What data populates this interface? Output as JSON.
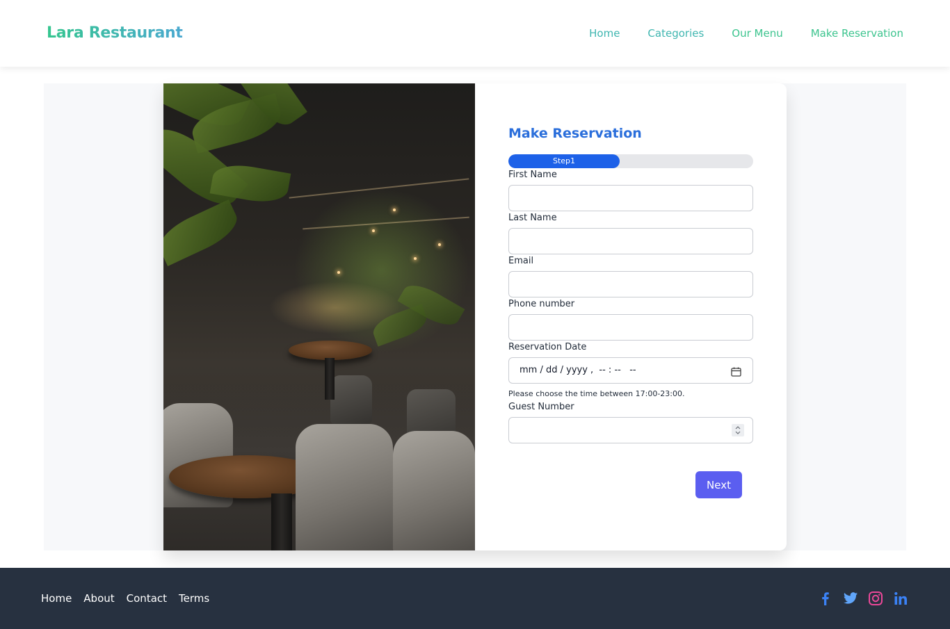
{
  "header": {
    "brand": "Lara Restaurant",
    "nav": [
      {
        "label": "Home"
      },
      {
        "label": "Categories"
      },
      {
        "label": "Our Menu"
      },
      {
        "label": "Make Reservation"
      }
    ]
  },
  "form": {
    "title": "Make Reservation",
    "progress": {
      "label": "Step1",
      "fraction": 0.45
    },
    "fields": {
      "first_name": {
        "label": "First Name",
        "value": ""
      },
      "last_name": {
        "label": "Last Name",
        "value": ""
      },
      "email": {
        "label": "Email",
        "value": ""
      },
      "phone": {
        "label": "Phone number",
        "value": ""
      },
      "reservation_date": {
        "label": "Reservation Date",
        "placeholder": "mm / dd / yyyy ,  -- : --   --",
        "help": "Please choose the time between 17:00-23:00."
      },
      "guest_number": {
        "label": "Guest Number",
        "value": ""
      }
    },
    "next_label": "Next"
  },
  "footer": {
    "links": [
      {
        "label": "Home"
      },
      {
        "label": "About"
      },
      {
        "label": "Contact"
      },
      {
        "label": "Terms"
      }
    ],
    "social": [
      "facebook-icon",
      "twitter-icon",
      "instagram-icon",
      "linkedin-icon"
    ]
  },
  "colors": {
    "brand_start": "#35c68f",
    "brand_end": "#4aa8d0",
    "form_title": "#2a6edb",
    "progress": "#1d61e8",
    "next_button": "#5b5ef0",
    "footer_bg": "#273140"
  }
}
